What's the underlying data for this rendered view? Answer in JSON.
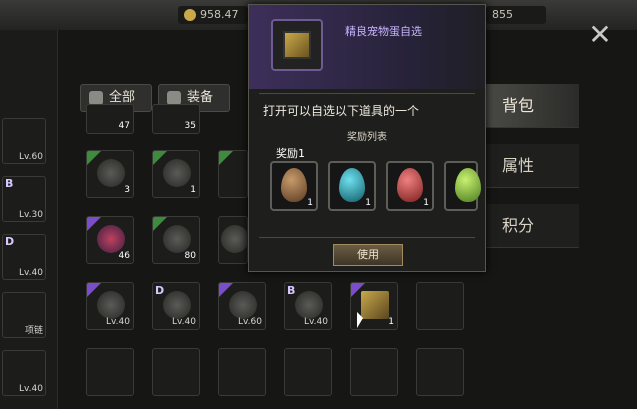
{
  "topbar": {
    "gold": "958.47",
    "gems": "855"
  },
  "tabs": {
    "all": "全部",
    "equip": "装备"
  },
  "side_tabs": {
    "bag": "背包",
    "attr": "属性",
    "score": "积分"
  },
  "left_column": [
    {
      "tag": "",
      "level": "Lv.60"
    },
    {
      "tag": "B",
      "level": "Lv.30"
    },
    {
      "tag": "D",
      "level": "Lv.40"
    },
    {
      "tag": "",
      "level": "项链"
    },
    {
      "tag": "",
      "level": "Lv.40"
    }
  ],
  "grid": [
    {
      "count": "47",
      "corner": "none"
    },
    {
      "count": "35",
      "corner": "none"
    },
    {
      "count": "3",
      "corner": "green"
    },
    {
      "count": "1",
      "corner": "green"
    },
    {
      "count": "",
      "corner": "green"
    },
    {
      "count": "46",
      "corner": "purple"
    },
    {
      "count": "80",
      "corner": "green"
    },
    {
      "count": "",
      "corner": "none"
    },
    {
      "level": "Lv.40",
      "tag": "",
      "corner": "purple"
    },
    {
      "level": "Lv.40",
      "tag": "D",
      "corner": "green"
    },
    {
      "level": "Lv.60",
      "tag": "",
      "corner": "purple"
    },
    {
      "level": "Lv.40",
      "tag": "B",
      "corner": "purple"
    },
    {
      "count": "1",
      "corner": "purple"
    }
  ],
  "popup": {
    "title": "精良宠物蛋自选",
    "description": "打开可以自选以下道具的一个",
    "list_title": "奖励列表",
    "reward_label": "奖励1",
    "rewards": [
      {
        "count": "1",
        "color": "#7a5a3a"
      },
      {
        "count": "1",
        "color": "#1e8c9c"
      },
      {
        "count": "1",
        "color": "#b33a3a"
      },
      {
        "count": "1",
        "color": "#7ab33a"
      }
    ],
    "use_label": "使用"
  }
}
